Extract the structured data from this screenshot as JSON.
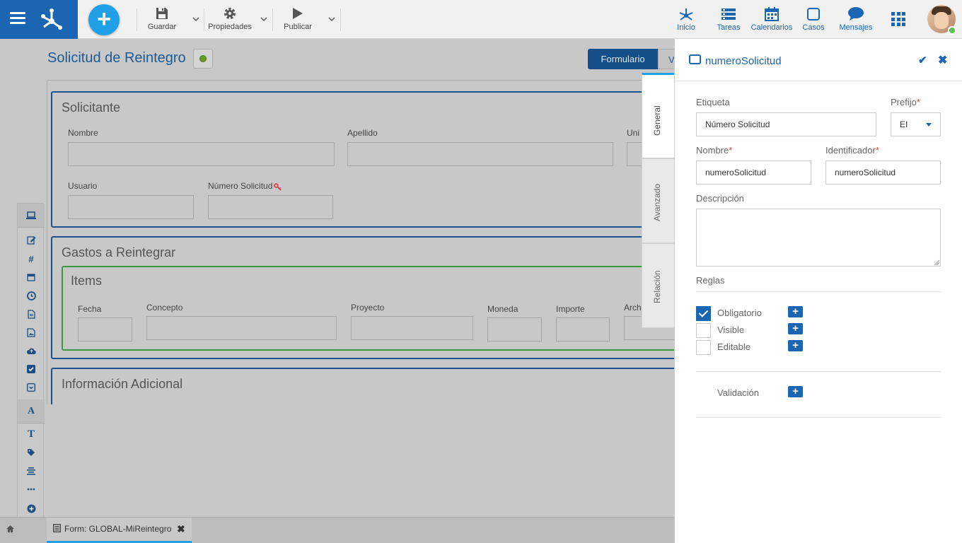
{
  "toolbar": {
    "save_label": "Guardar",
    "properties_label": "Propiedades",
    "publish_label": "Publicar"
  },
  "nav": {
    "inicio": "Inicio",
    "tareas": "Tareas",
    "calendarios": "Calendarios",
    "casos": "Casos",
    "mensajes": "Mensajes"
  },
  "canvas": {
    "title": "Solicitud de Reintegro",
    "view_active": "Formulario",
    "view_other": "V",
    "sections": {
      "solicitante": {
        "title": "Solicitante",
        "fields": [
          "Nombre",
          "Apellido",
          "Uni",
          "Usuario",
          "Número Solicitud"
        ]
      },
      "gastos": {
        "title": "Gastos a Reintegrar",
        "grid_title": "Items",
        "columns": [
          "Fecha",
          "Concepto",
          "Proyecto",
          "Moneda",
          "Importe",
          "Arch"
        ]
      },
      "adicional": {
        "title": "Información Adicional"
      }
    }
  },
  "bottom_tab": {
    "label": "Form: GLOBAL-MiReintegro"
  },
  "vertical_tabs": [
    "General",
    "Avanzado",
    "Relación"
  ],
  "panel": {
    "title": "numeroSolicitud",
    "etiqueta_label": "Etiqueta",
    "etiqueta_value": "Número Solicitud",
    "prefijo_label": "Prefijo",
    "prefijo_value": "EI",
    "nombre_label": "Nombre",
    "nombre_value": "numeroSolicitud",
    "identificador_label": "Identificador",
    "identificador_value": "numeroSolicitud",
    "descripcion_label": "Descripción",
    "reglas_label": "Reglas",
    "reglas": [
      {
        "label": "Obligatorio",
        "checked": true
      },
      {
        "label": "Visible",
        "checked": false
      },
      {
        "label": "Editable",
        "checked": false
      }
    ],
    "validacion_label": "Validación",
    "required_mark": "*"
  },
  "colors": {
    "brand": "#1a66b3",
    "accent": "#1fa0e8",
    "section_border": "#1c528e",
    "grid_border": "#3a9a3a"
  }
}
